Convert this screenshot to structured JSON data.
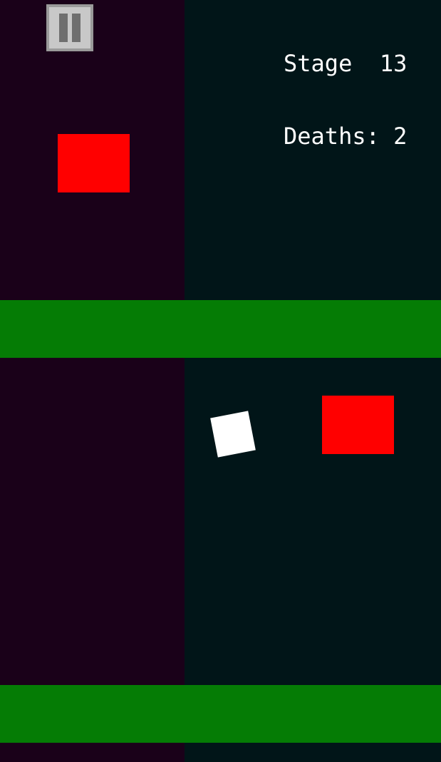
{
  "hud": {
    "stage_label": "Stage",
    "stage_number": "13",
    "deaths_label": "Deaths:",
    "deaths_count": "2"
  },
  "pause_button": {
    "icon": "pause-icon"
  },
  "colors": {
    "left_background": "#1a0119",
    "right_background": "#011518",
    "platform": "#057c05",
    "hazard": "#ff0000",
    "player": "#ffffff"
  }
}
